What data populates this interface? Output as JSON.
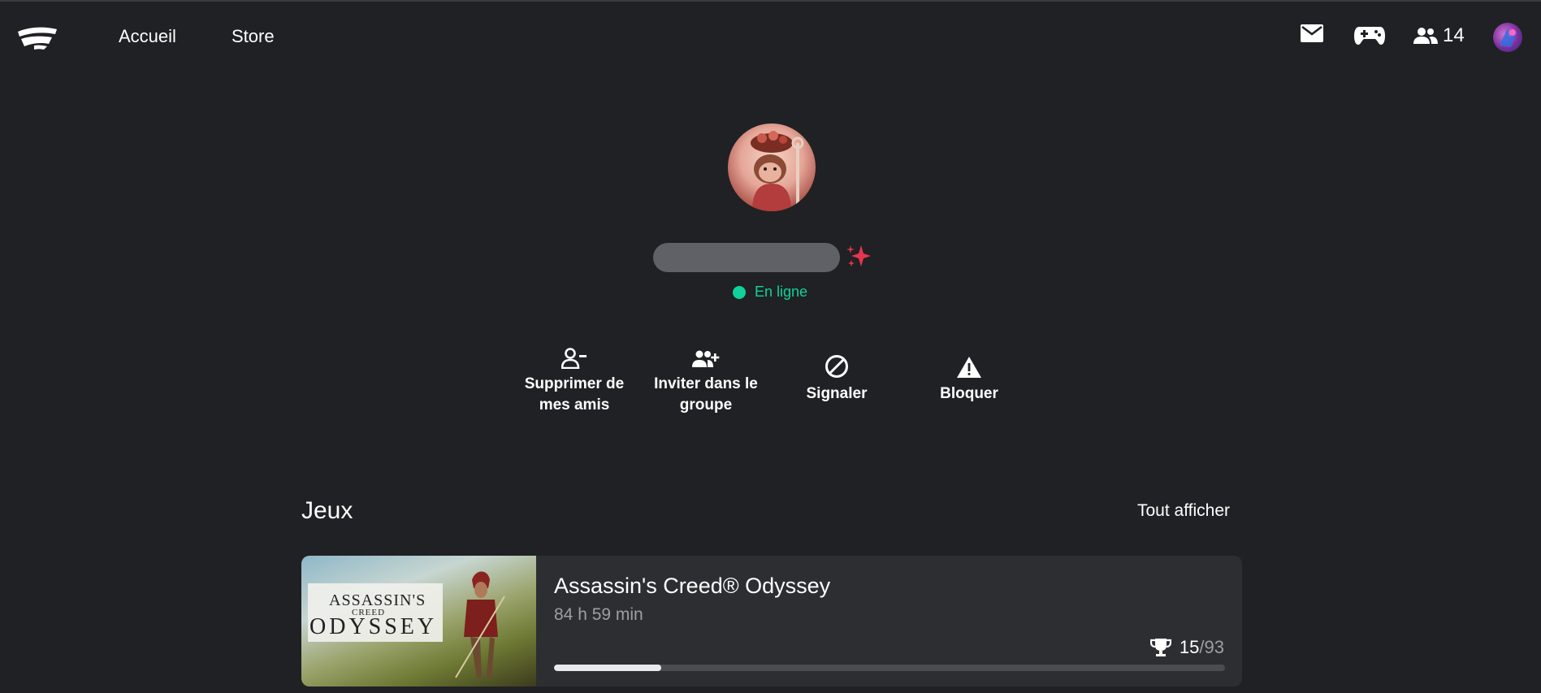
{
  "header": {
    "nav": [
      {
        "label": "Accueil"
      },
      {
        "label": "Store"
      }
    ],
    "icons": [
      "stadia-logo",
      "mail-icon",
      "controller-icon",
      "friends-icon"
    ],
    "friends_count": "14"
  },
  "profile": {
    "status": "En ligne",
    "status_color": "#10d29b",
    "accent_color": "#e8344e"
  },
  "actions": [
    {
      "label": "Supprimer de mes amis",
      "icon": "remove-friend-icon"
    },
    {
      "label": "Inviter dans le groupe",
      "icon": "invite-group-icon"
    },
    {
      "label": "Signaler",
      "icon": "report-icon"
    },
    {
      "label": "Bloquer",
      "icon": "block-warning-icon"
    }
  ],
  "games": {
    "title": "Jeux",
    "see_all": "Tout afficher",
    "items": [
      {
        "name": "Assassin's Creed® Odyssey",
        "playtime": "84 h 59 min",
        "trophies_earned": "15",
        "trophies_total": "/93",
        "progress": 0.16,
        "art_text": [
          "ASSASSIN'S",
          "CREED",
          "ODYSSEY"
        ]
      }
    ]
  }
}
